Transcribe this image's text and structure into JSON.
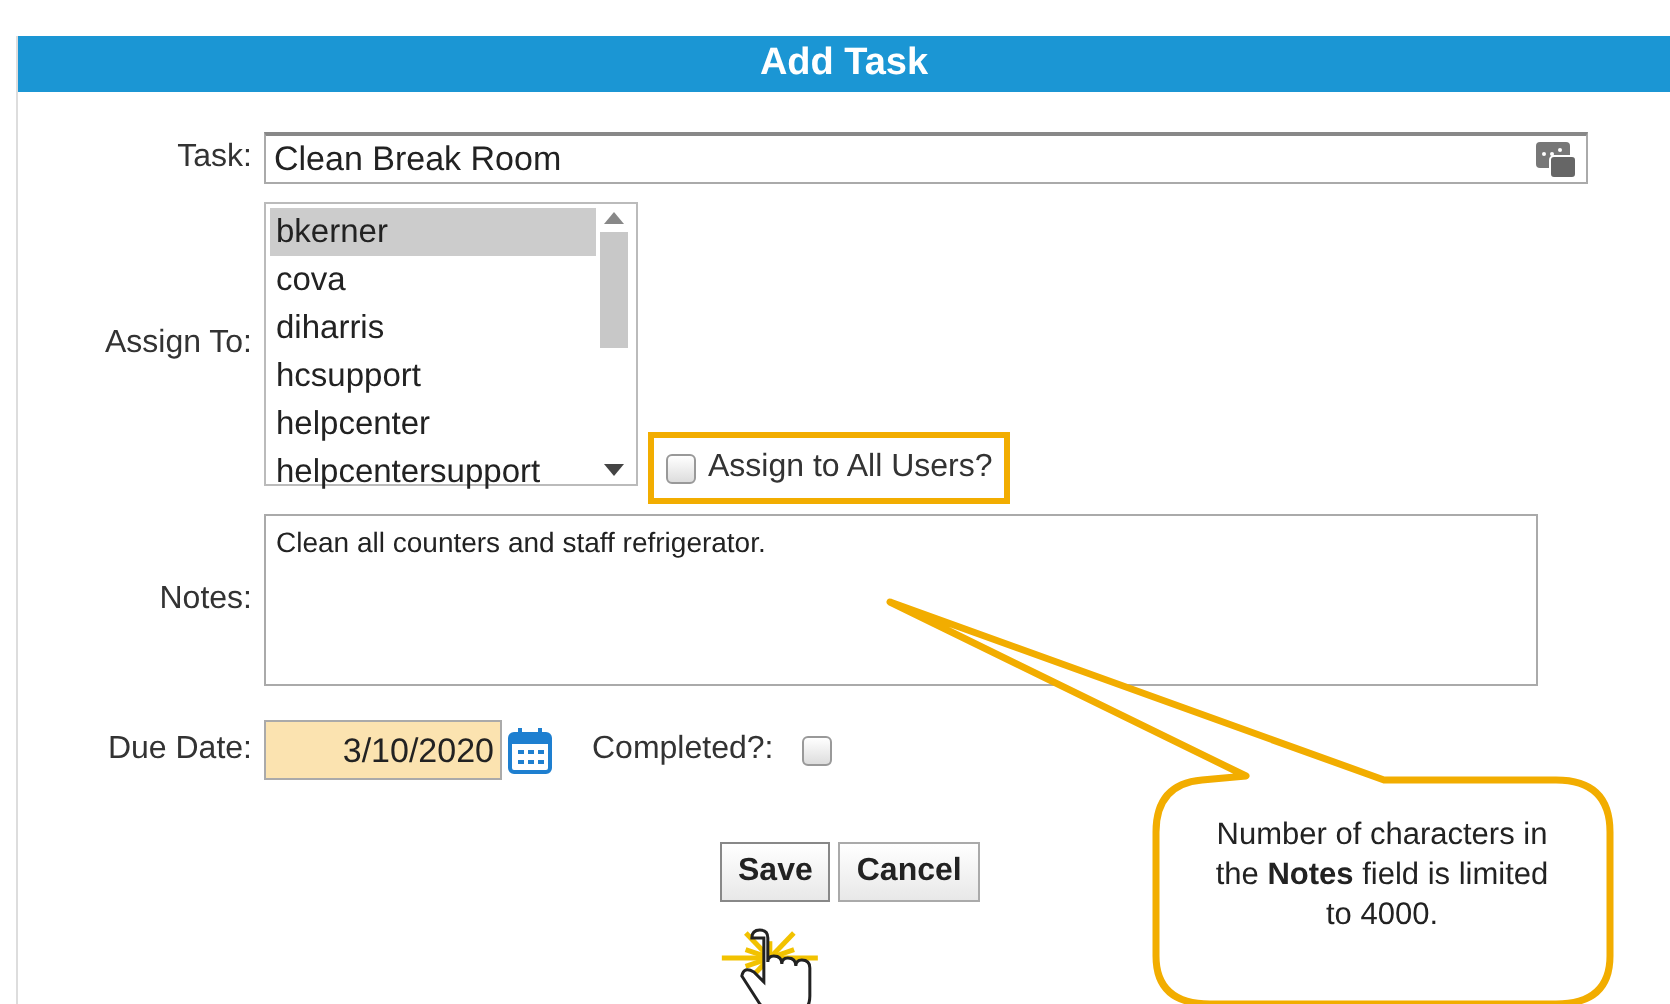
{
  "dialog": {
    "title": "Add Task"
  },
  "task": {
    "label": "Task:",
    "value": "Clean Break Room"
  },
  "assign_to": {
    "label": "Assign To:",
    "users": [
      {
        "name": "bkerner",
        "selected": true
      },
      {
        "name": "cova",
        "selected": false
      },
      {
        "name": "diharris",
        "selected": false
      },
      {
        "name": "hcsupport",
        "selected": false
      },
      {
        "name": "helpcenter",
        "selected": false
      },
      {
        "name": "helpcentersupport",
        "selected": false
      }
    ]
  },
  "assign_all": {
    "label": "Assign to All Users?",
    "checked": false,
    "highlighted": true
  },
  "notes": {
    "label": "Notes:",
    "value": "Clean all counters and staff refrigerator."
  },
  "due_date": {
    "label": "Due Date:",
    "value": "3/10/2020"
  },
  "completed": {
    "label": "Completed?:",
    "checked": false
  },
  "buttons": [
    {
      "label": "Save",
      "clicked": true
    },
    {
      "label": "Cancel",
      "clicked": false
    }
  ],
  "callout": {
    "text": "Number of characters in the **Notes** field is limited to 4000."
  }
}
